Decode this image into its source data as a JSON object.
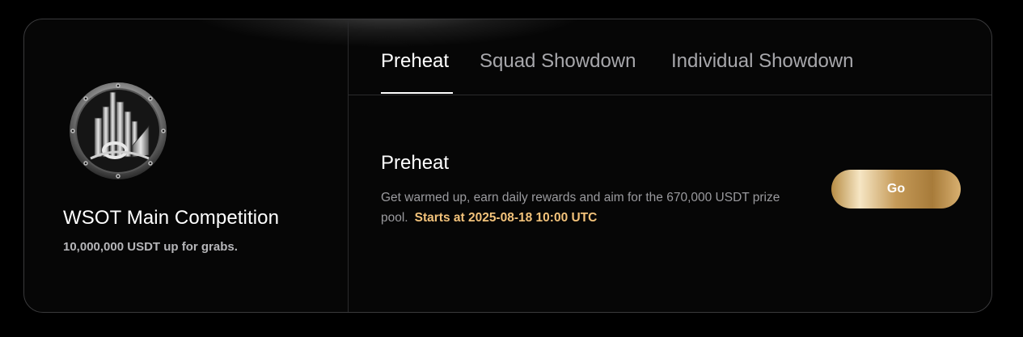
{
  "competition": {
    "title": "WSOT Main Competition",
    "subtitle": "10,000,000 USDT up for grabs."
  },
  "tabs": [
    {
      "label": "Preheat",
      "active": true
    },
    {
      "label": "Squad Showdown",
      "active": false
    },
    {
      "label": "Individual Showdown",
      "active": false
    }
  ],
  "section": {
    "title": "Preheat",
    "description": "Get warmed up, earn daily rewards and aim for the 670,000 USDT prize pool.",
    "start_text": "Starts at 2025-08-18 10:00 UTC",
    "button_label": "Go"
  },
  "colors": {
    "accent_gold": "#f2c27a",
    "background": "#000000"
  },
  "icons": {
    "logo": "city-skyline-emblem-icon"
  }
}
